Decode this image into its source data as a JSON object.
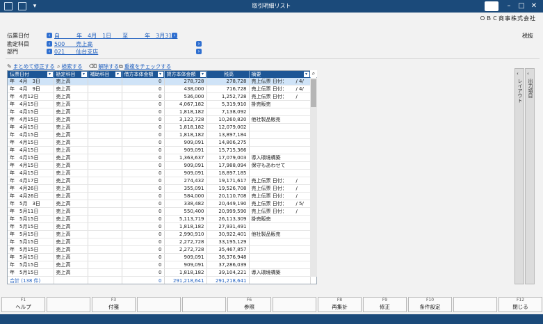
{
  "window": {
    "title": "取引明細リスト",
    "company": "ＯＢＣ商事株式会社",
    "tax_mode": "税抜"
  },
  "filters": [
    {
      "label": "伝票日付",
      "value": "自　　　年　4月　1日　　至　　　年　3月31日"
    },
    {
      "label": "勘定科目",
      "value": "500　　売上高"
    },
    {
      "label": "部門",
      "value": "021　　仙台支店"
    }
  ],
  "toolbar": {
    "bulk_edit": "まとめて修正する",
    "search": "検索する",
    "clear": "解除する",
    "duplicate_check": "重複をチェックする"
  },
  "columns": [
    "伝票日付",
    "勘定科目",
    "補助科目",
    "借方本体金額",
    "貸方本体金額",
    "残高",
    "摘要"
  ],
  "rows": [
    {
      "date": "年　4月　3日",
      "account": "売上高",
      "sub": "",
      "debit": "0",
      "credit": "278,728",
      "balance": "278,728",
      "memo": "売上伝票 日付：　　 / 4/"
    },
    {
      "date": "年　4月　9日",
      "account": "売上高",
      "sub": "",
      "debit": "0",
      "credit": "438,000",
      "balance": "716,728",
      "memo": "売上伝票 日付：　　 / 4/"
    },
    {
      "date": "年　4月12日",
      "account": "売上高",
      "sub": "",
      "debit": "0",
      "credit": "536,000",
      "balance": "1,252,728",
      "memo": "売上伝票 日付：　　 /"
    },
    {
      "date": "年　4月15日",
      "account": "売上高",
      "sub": "",
      "debit": "0",
      "credit": "4,067,182",
      "balance": "5,319,910",
      "memo": "掛売販売"
    },
    {
      "date": "年　4月15日",
      "account": "売上高",
      "sub": "",
      "debit": "0",
      "credit": "1,818,182",
      "balance": "7,138,092",
      "memo": ""
    },
    {
      "date": "年　4月15日",
      "account": "売上高",
      "sub": "",
      "debit": "0",
      "credit": "3,122,728",
      "balance": "10,260,820",
      "memo": "他社製品販売"
    },
    {
      "date": "年　4月15日",
      "account": "売上高",
      "sub": "",
      "debit": "0",
      "credit": "1,818,182",
      "balance": "12,079,002",
      "memo": ""
    },
    {
      "date": "年　4月15日",
      "account": "売上高",
      "sub": "",
      "debit": "0",
      "credit": "1,818,182",
      "balance": "13,897,184",
      "memo": ""
    },
    {
      "date": "年　4月15日",
      "account": "売上高",
      "sub": "",
      "debit": "0",
      "credit": "909,091",
      "balance": "14,806,275",
      "memo": ""
    },
    {
      "date": "年　4月15日",
      "account": "売上高",
      "sub": "",
      "debit": "0",
      "credit": "909,091",
      "balance": "15,715,366",
      "memo": ""
    },
    {
      "date": "年　4月15日",
      "account": "売上高",
      "sub": "",
      "debit": "0",
      "credit": "1,363,637",
      "balance": "17,079,003",
      "memo": "導入環境構築"
    },
    {
      "date": "年　4月15日",
      "account": "売上高",
      "sub": "",
      "debit": "0",
      "credit": "909,091",
      "balance": "17,988,094",
      "memo": "保守もあわせて"
    },
    {
      "date": "年　4月15日",
      "account": "売上高",
      "sub": "",
      "debit": "0",
      "credit": "909,091",
      "balance": "18,897,185",
      "memo": ""
    },
    {
      "date": "年　4月17日",
      "account": "売上高",
      "sub": "",
      "debit": "0",
      "credit": "274,432",
      "balance": "19,171,617",
      "memo": "売上伝票 日付：　　 /"
    },
    {
      "date": "年　4月26日",
      "account": "売上高",
      "sub": "",
      "debit": "0",
      "credit": "355,091",
      "balance": "19,526,708",
      "memo": "売上伝票 日付：　　 /"
    },
    {
      "date": "年　4月26日",
      "account": "売上高",
      "sub": "",
      "debit": "0",
      "credit": "584,000",
      "balance": "20,110,708",
      "memo": "売上伝票 日付：　　 /"
    },
    {
      "date": "年　5月　3日",
      "account": "売上高",
      "sub": "",
      "debit": "0",
      "credit": "338,482",
      "balance": "20,449,190",
      "memo": "売上伝票 日付：　　 / 5/"
    },
    {
      "date": "年　5月11日",
      "account": "売上高",
      "sub": "",
      "debit": "0",
      "credit": "550,400",
      "balance": "20,999,590",
      "memo": "売上伝票 日付：　　 /"
    },
    {
      "date": "年　5月15日",
      "account": "売上高",
      "sub": "",
      "debit": "0",
      "credit": "5,113,719",
      "balance": "26,113,309",
      "memo": "掛売販売"
    },
    {
      "date": "年　5月15日",
      "account": "売上高",
      "sub": "",
      "debit": "0",
      "credit": "1,818,182",
      "balance": "27,931,491",
      "memo": ""
    },
    {
      "date": "年　5月15日",
      "account": "売上高",
      "sub": "",
      "debit": "0",
      "credit": "2,990,910",
      "balance": "30,922,401",
      "memo": "他社製品販売"
    },
    {
      "date": "年　5月15日",
      "account": "売上高",
      "sub": "",
      "debit": "0",
      "credit": "2,272,728",
      "balance": "33,195,129",
      "memo": ""
    },
    {
      "date": "年　5月15日",
      "account": "売上高",
      "sub": "",
      "debit": "0",
      "credit": "2,272,728",
      "balance": "35,467,857",
      "memo": ""
    },
    {
      "date": "年　5月15日",
      "account": "売上高",
      "sub": "",
      "debit": "0",
      "credit": "909,091",
      "balance": "36,376,948",
      "memo": ""
    },
    {
      "date": "年　5月15日",
      "account": "売上高",
      "sub": "",
      "debit": "0",
      "credit": "909,091",
      "balance": "37,286,039",
      "memo": ""
    },
    {
      "date": "年　5月15日",
      "account": "売上高",
      "sub": "",
      "debit": "0",
      "credit": "1,818,182",
      "balance": "39,104,221",
      "memo": "導入環境構築"
    }
  ],
  "total": {
    "label": "合計 (138 件)",
    "debit": "0",
    "credit": "291,218,641",
    "balance": "291,218,641"
  },
  "side_tabs": [
    "出力項目",
    "レイアウト"
  ],
  "fkeys": [
    {
      "key": "F1",
      "label": "ヘルプ"
    },
    {
      "key": "",
      "label": ""
    },
    {
      "key": "F3",
      "label": "付箋"
    },
    {
      "key": "",
      "label": ""
    },
    {
      "key": "",
      "label": ""
    },
    {
      "key": "F6",
      "label": "参照"
    },
    {
      "key": "",
      "label": ""
    },
    {
      "key": "F8",
      "label": "再集計"
    },
    {
      "key": "F9",
      "label": "修正"
    },
    {
      "key": "F10",
      "label": "条件設定"
    },
    {
      "key": "",
      "label": ""
    },
    {
      "key": "F12",
      "label": "閉じる"
    }
  ]
}
